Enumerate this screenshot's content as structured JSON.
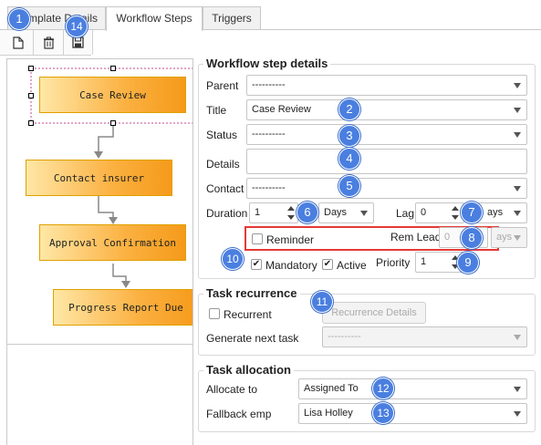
{
  "tabs": [
    {
      "label": "Template Details",
      "visible_label": "mplate Details"
    },
    {
      "label": "Workflow Steps"
    },
    {
      "label": "Triggers"
    }
  ],
  "toolbar": {
    "icons": [
      "new-document-icon",
      "trash-icon",
      "save-icon"
    ]
  },
  "diagram": {
    "nodes": [
      "Case Review",
      "Contact insurer",
      "Approval Confirmation",
      "Progress Report Due"
    ]
  },
  "details": {
    "legend": "Workflow step details",
    "parent": {
      "label": "Parent",
      "value": "----------"
    },
    "title": {
      "label": "Title",
      "value": "Case Review"
    },
    "status": {
      "label": "Status",
      "value": "----------"
    },
    "details": {
      "label": "Details",
      "value": ""
    },
    "contact": {
      "label": "Contact",
      "value": "----------"
    },
    "duration": {
      "label": "Duration",
      "value": "1",
      "unit": "Days"
    },
    "lag": {
      "label": "Lag",
      "value": "0",
      "unit": "Days",
      "unit_visible": "ays"
    },
    "reminder": {
      "label": "Reminder",
      "checked": false
    },
    "rem_lead": {
      "label": "Rem Lead",
      "value": "0",
      "unit_visible": "ays"
    },
    "mandatory": {
      "label": "Mandatory",
      "checked": true
    },
    "active": {
      "label": "Active",
      "checked": true
    },
    "priority": {
      "label": "Priority",
      "value": "1"
    }
  },
  "recurrence": {
    "legend": "Task recurrence",
    "recurrent": {
      "label": "Recurrent",
      "checked": false
    },
    "button": "Recurrence Details",
    "generate_label": "Generate next task",
    "generate_value": "----------"
  },
  "allocation": {
    "legend": "Task allocation",
    "allocate_label": "Allocate to",
    "allocate_value": "Assigned To",
    "fallback_label": "Fallback emp",
    "fallback_value": "Lisa Holley"
  },
  "badges": [
    "1",
    "2",
    "3",
    "4",
    "5",
    "6",
    "7",
    "8",
    "9",
    "10",
    "11",
    "12",
    "13",
    "14"
  ],
  "colors": {
    "badge": "#4a7fe0",
    "highlight": "#e53935",
    "node_fill": "#fbb040"
  }
}
